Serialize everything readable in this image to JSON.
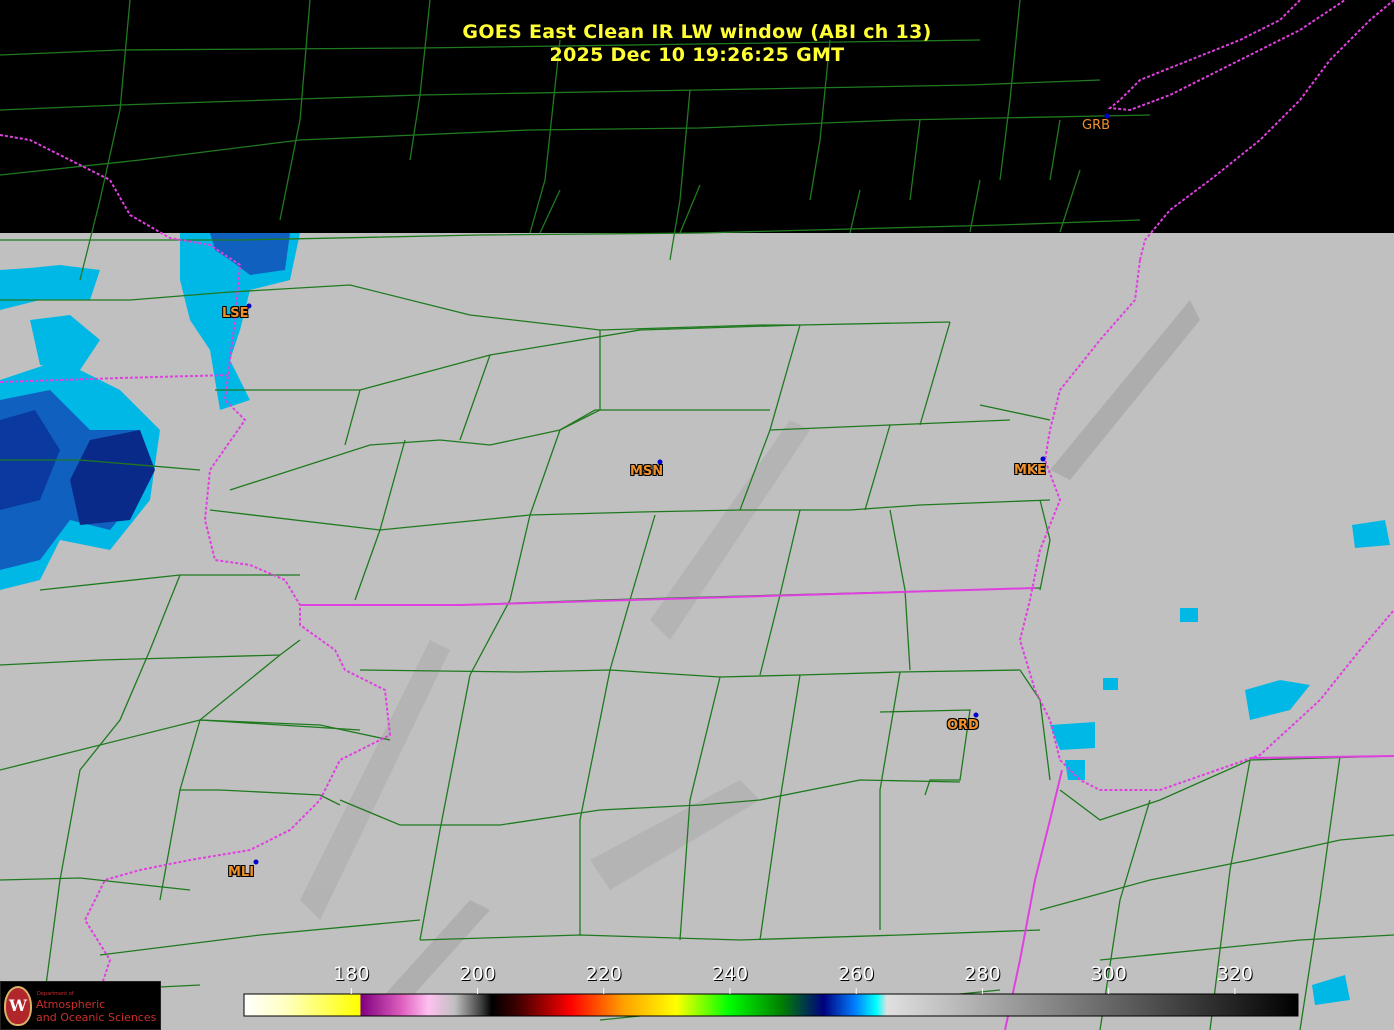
{
  "title": {
    "line1": "GOES East Clean IR LW window (ABI ch 13)",
    "line2": "2025 Dec 10  19:26:25 GMT"
  },
  "stations": [
    {
      "id": "GRB"
    },
    {
      "id": "LSE"
    },
    {
      "id": "MSN"
    },
    {
      "id": "MKE"
    },
    {
      "id": "ORD"
    },
    {
      "id": "MLI"
    }
  ],
  "colorbar": {
    "units_note": "",
    "ticks": [
      "180",
      "200",
      "220",
      "240",
      "260",
      "280",
      "300",
      "320"
    ],
    "min": 163,
    "max": 330
  },
  "logo": {
    "seal_letter": "W",
    "dept": "Department of",
    "line1": "Atmospheric",
    "line2": "and Oceanic Sciences"
  },
  "colors": {
    "title": "#ffff33",
    "county_lines": "#1f7a1f",
    "state_lines": "#e040e0",
    "station_dot": "#0000cc",
    "station_label": "#f0902a",
    "background_gray": "#c0c0c0",
    "no_data": "#000000"
  }
}
